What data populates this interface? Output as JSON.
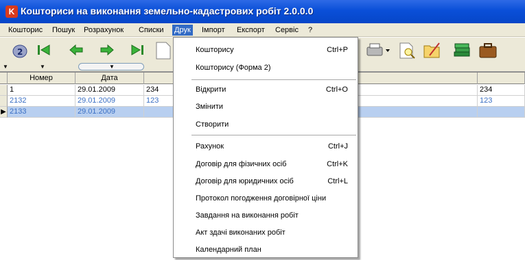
{
  "window": {
    "title": "Кошториси на виконання земельно-кадастрових робіт 2.0.0.0",
    "icon": "app-logo-icon"
  },
  "menubar": [
    "Кошторис",
    "Пошук",
    "Розрахунок",
    "Списки",
    "Друк",
    "Імпорт",
    "Експорт",
    "Сервіс",
    "?"
  ],
  "menubar_active": "Друк",
  "toolbar": {
    "icons": [
      "refresh-icon",
      "first-record-icon",
      "prev-record-icon",
      "next-record-icon",
      "last-record-icon",
      "new-document-icon",
      "print-icon",
      "print-preview-icon",
      "edit-document-icon",
      "books-icon",
      "briefcase-icon"
    ]
  },
  "grid": {
    "columns": [
      "Номер",
      "Дата"
    ],
    "rows": [
      {
        "num": "1",
        "date": "29.01.2009",
        "c3": "234",
        "c4": "234",
        "style": "normal"
      },
      {
        "num": "2132",
        "date": "29.01.2009",
        "c3": "123",
        "c4": "123",
        "style": "blue"
      },
      {
        "num": "2133",
        "date": "29.01.2009",
        "c3": "",
        "c4": "",
        "style": "selected"
      }
    ]
  },
  "dropdown": {
    "items": [
      {
        "label": "Кошторису",
        "shortcut": "Ctrl+P"
      },
      {
        "label": "Кошторису (Форма 2)",
        "shortcut": ""
      },
      {
        "label": "Відкрити",
        "shortcut": "Ctrl+O"
      },
      {
        "label": "Змінити",
        "shortcut": ""
      },
      {
        "label": "Створити",
        "shortcut": ""
      },
      {
        "label": "Рахунок",
        "shortcut": "Ctrl+J"
      },
      {
        "label": "Договір для фізичних осіб",
        "shortcut": "Ctrl+K"
      },
      {
        "label": "Договір для юридичних осіб",
        "shortcut": "Ctrl+L"
      },
      {
        "label": "Протокол погодження договірної ціни",
        "shortcut": ""
      },
      {
        "label": "Завдання на виконання робіт",
        "shortcut": ""
      },
      {
        "label": "Акт здачі виконаних робіт",
        "shortcut": ""
      },
      {
        "label": "Календарний план",
        "shortcut": ""
      }
    ]
  },
  "colors": {
    "titlebar": "#0a4fd8",
    "menu_highlight": "#316ac5",
    "selected_row": "#b8cff0",
    "link_blue": "#3a6fc4"
  }
}
